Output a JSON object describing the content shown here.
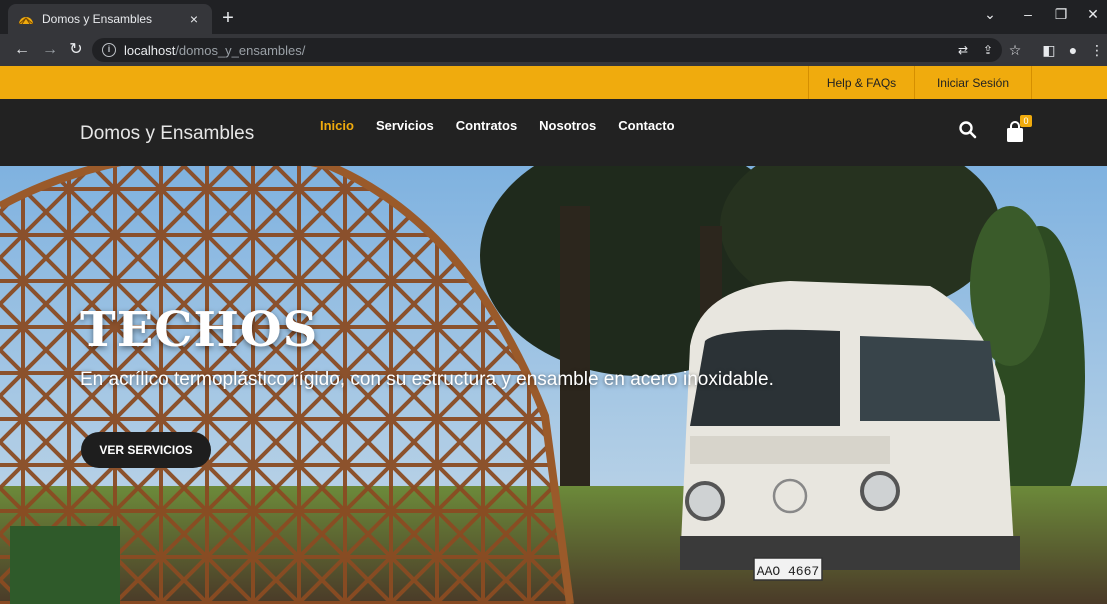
{
  "browser": {
    "tab_title": "Domos y Ensambles",
    "tab_close": "×",
    "new_tab": "+",
    "url_host": "localhost",
    "url_path": "/domos_y_ensambles/"
  },
  "site": {
    "topbar": {
      "help_label": "Help & FAQs",
      "login_label": "Iniciar Sesión"
    },
    "logo": "Domos y Ensambles",
    "menu": [
      {
        "label": "Inicio",
        "active": true
      },
      {
        "label": "Servicios"
      },
      {
        "label": "Contratos"
      },
      {
        "label": "Nosotros"
      },
      {
        "label": "Contacto"
      }
    ],
    "cart_count": "0",
    "icons": {
      "search": "search-icon",
      "cart": "shopping-bag-icon"
    },
    "colors": {
      "accent": "#f0ab0d",
      "header_bg": "#222222"
    }
  },
  "hero": {
    "title": "TECHOS",
    "subtitle": "En acrílico termoplástico rígido, con su estructura y ensamble en acero inoxidable.",
    "button_label": "VER SERVICIOS",
    "plate_text": "AAO 4667"
  }
}
